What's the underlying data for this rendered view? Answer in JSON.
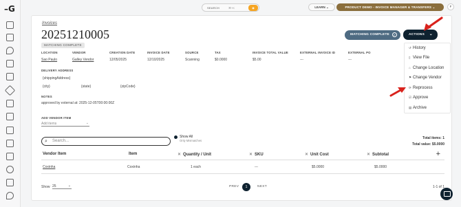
{
  "topbar": {
    "search_label": "SEARCH",
    "search_shortcut": "⌘+K",
    "learn_label": "LEARN",
    "demo_label": "PRODUCT DEMO - INVOICE MANAGER & TRANSFERS",
    "avatar_initial": "F"
  },
  "header": {
    "breadcrumb": "Invoices",
    "title": "20251210005",
    "status_badge": "MATCHING COMPLETE",
    "match_button": "MATCHING COMPLETE",
    "actions_button": "ACTIONS"
  },
  "actions_menu": [
    {
      "icon": "history-icon",
      "label": "History"
    },
    {
      "icon": "file-icon",
      "label": "View File"
    },
    {
      "icon": "location-icon",
      "label": "Change Location"
    },
    {
      "icon": "vendor-icon",
      "label": "Change Vendor"
    },
    {
      "icon": "reprocess-icon",
      "label": "Reprocess"
    },
    {
      "icon": "approve-icon",
      "label": "Approve"
    },
    {
      "icon": "archive-icon",
      "label": "Archive"
    }
  ],
  "fields": {
    "location_label": "LOCATION",
    "location_value": "Sao Paulo",
    "vendor_label": "VENDOR",
    "vendor_value": "Galley Vendor",
    "creation_date_label": "CREATION DATE",
    "creation_date_value": "12/05/2025",
    "invoice_date_label": "INVOICE DATE",
    "invoice_date_value": "12/10/2025",
    "source_label": "SOURCE",
    "source_value": "Scanning",
    "tax_label": "TAX",
    "tax_value": "$0.0000",
    "total_label": "INVOICE TOTAL VALUE",
    "total_value": "$5.00",
    "ext_invoice_label": "EXTERNAL INVOICE ID",
    "ext_invoice_value": "---",
    "ext_po_label": "EXTERNAL PO",
    "ext_po_value": "---",
    "delivery_label": "DELIVERY ADDRESS",
    "shipping_address": "{shippingAddress}",
    "city": "{city}",
    "state": "{state}",
    "zip": "{zipCode}",
    "notes_label": "NOTES",
    "notes_value": "approved by external at: 2025-12-05T00:00:00Z",
    "add_vendor_item_label": "ADD VENDOR ITEM",
    "add_items_placeholder": "Add items"
  },
  "table": {
    "search_placeholder": "Search...",
    "show_all": "Show All",
    "only_mismatches": "Only Mismatches",
    "total_items": "Total items: 1",
    "total_value": "Total value: $5.0000",
    "columns": [
      "Vendor Item",
      "Item",
      "Quantity / Unit",
      "SKU",
      "Unit Cost",
      "Subtotal"
    ],
    "rows": [
      [
        "Coxinha",
        "Coxinha",
        "1 each",
        "---",
        "$5.0000",
        "$5.0000"
      ]
    ]
  },
  "footer": {
    "show_label": "Show",
    "page_size": "25",
    "prev": "PREV",
    "page": "1",
    "next": "NEXT",
    "range": "1-1 of 1"
  }
}
